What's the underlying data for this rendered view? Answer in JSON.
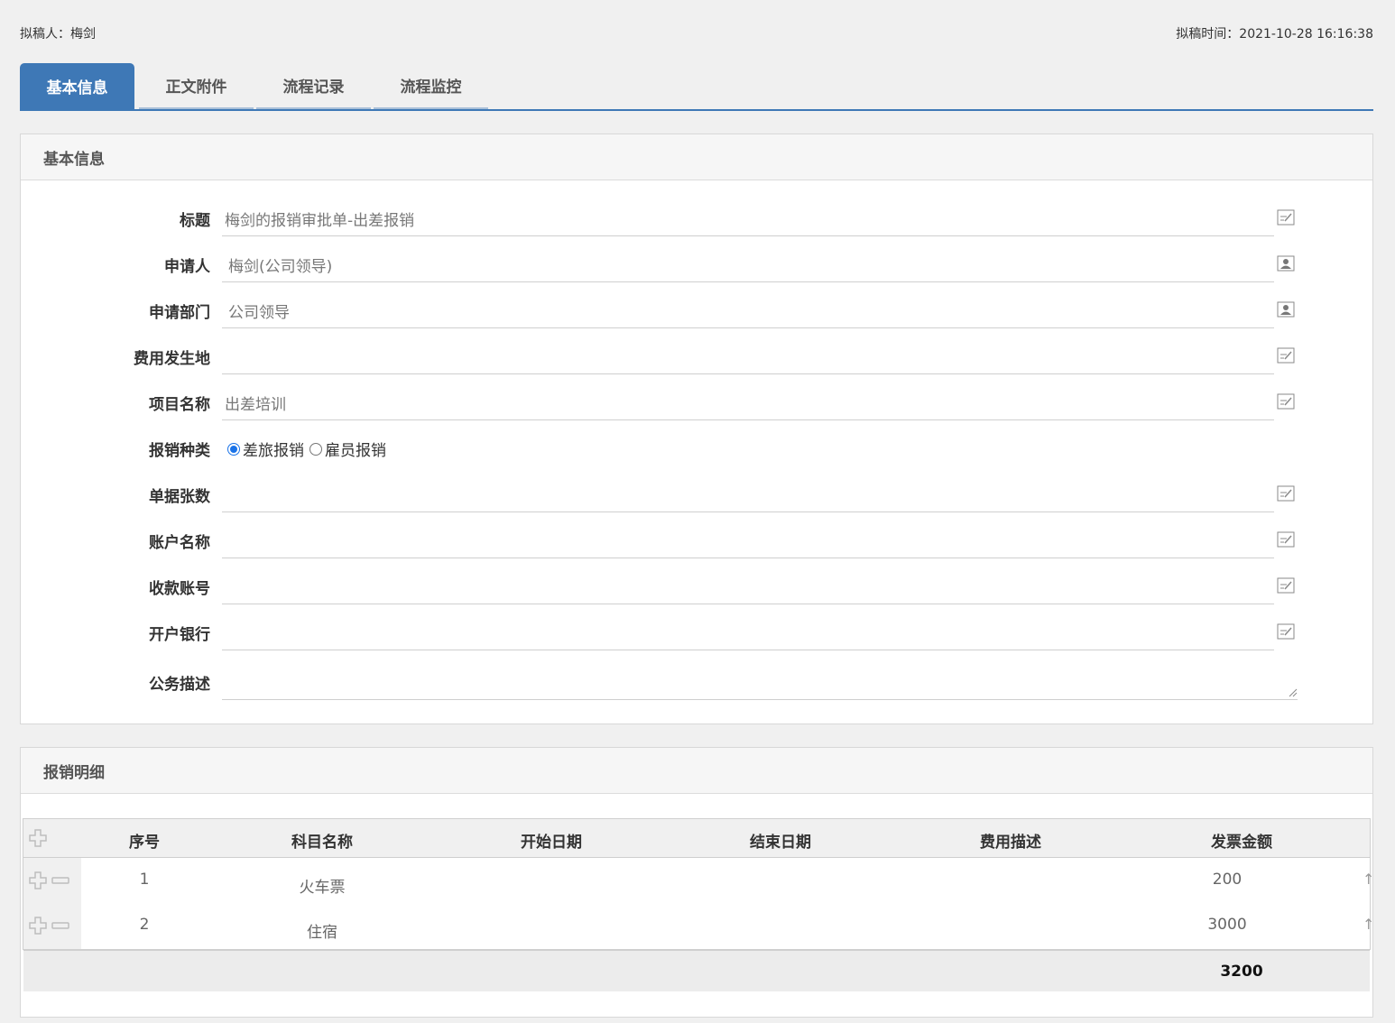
{
  "meta": {
    "drafter": "拟稿人：梅剑",
    "draft_time": "拟稿时间：2021-10-28 16:16:38"
  },
  "tabs": [
    {
      "label": "基本信息",
      "active": true
    },
    {
      "label": "正文附件",
      "active": false
    },
    {
      "label": "流程记录",
      "active": false
    },
    {
      "label": "流程监控",
      "active": false
    }
  ],
  "basic": {
    "title": "基本信息",
    "fields": {
      "title": {
        "label": "标题",
        "value": "梅剑的报销审批单-出差报销",
        "icon": "edit-icon"
      },
      "applicant": {
        "label": "申请人",
        "value": "梅剑(公司领导)",
        "icon": "user-picker-icon"
      },
      "department": {
        "label": "申请部门",
        "value": "公司领导",
        "icon": "user-picker-icon"
      },
      "location": {
        "label": "费用发生地",
        "value": "",
        "icon": "edit-icon"
      },
      "project": {
        "label": "项目名称",
        "value": "出差培训",
        "icon": "edit-icon"
      },
      "type": {
        "label": "报销种类",
        "options": [
          "差旅报销",
          "雇员报销"
        ],
        "selected": "差旅报销"
      },
      "receipts": {
        "label": "单据张数",
        "value": "",
        "icon": "edit-icon"
      },
      "account_name": {
        "label": "账户名称",
        "value": "",
        "icon": "edit-icon"
      },
      "account_no": {
        "label": "收款账号",
        "value": "",
        "icon": "edit-icon"
      },
      "bank": {
        "label": "开户银行",
        "value": "",
        "icon": "edit-icon"
      },
      "desc": {
        "label": "公务描述",
        "value": ""
      }
    }
  },
  "detail": {
    "title": "报销明细",
    "columns": [
      "序号",
      "科目名称",
      "开始日期",
      "结束日期",
      "费用描述",
      "发票金额"
    ],
    "rows": [
      {
        "no": "1",
        "subject": "火车票",
        "start": "",
        "end": "",
        "desc": "",
        "amount": "200"
      },
      {
        "no": "2",
        "subject": "住宿",
        "start": "",
        "end": "",
        "desc": "",
        "amount": "3000"
      }
    ],
    "total": "3200"
  }
}
